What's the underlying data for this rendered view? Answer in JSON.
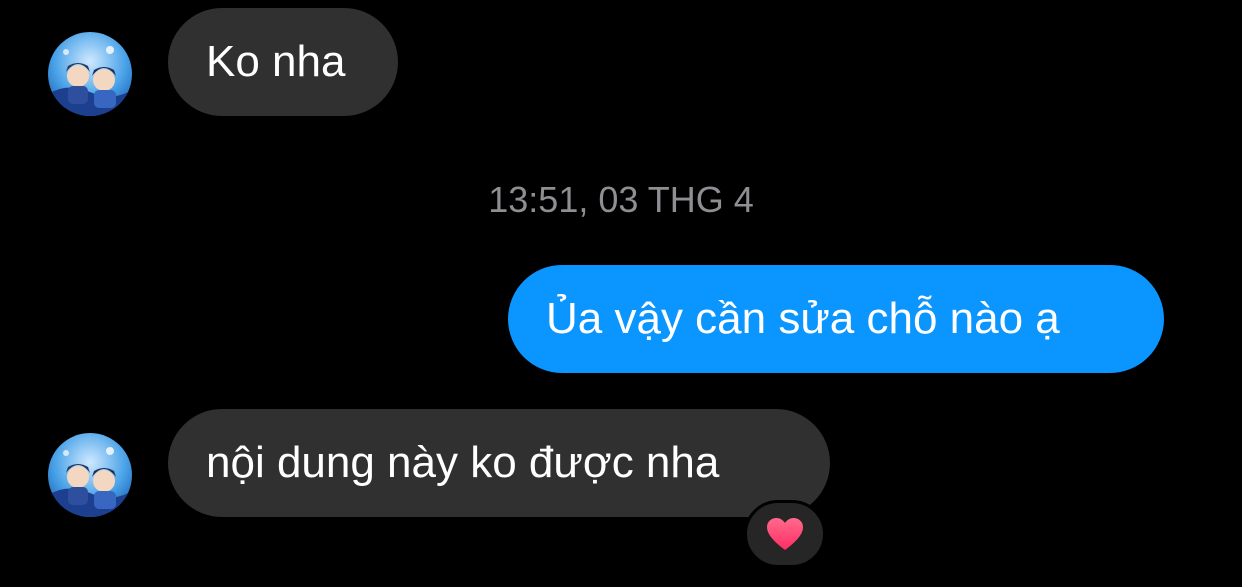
{
  "conversation": {
    "messages": [
      {
        "sender": "other",
        "text": "Ko nha"
      },
      {
        "sender": "self",
        "text": "Ủa vậy cần sửa chỗ nào ạ"
      },
      {
        "sender": "other",
        "text": "nội dung này ko được nha",
        "reaction_icon": "heart-icon"
      }
    ],
    "timestamp": "13:51, 03 THG 4"
  },
  "colors": {
    "background": "#000000",
    "incoming_bubble": "#303030",
    "outgoing_bubble": "#0a95ff",
    "timestamp_text": "#8e8e93",
    "reaction_heart": "#ff3b6b"
  },
  "icons": {
    "avatar": "anime-avatar-icon",
    "reaction": "heart-icon"
  }
}
